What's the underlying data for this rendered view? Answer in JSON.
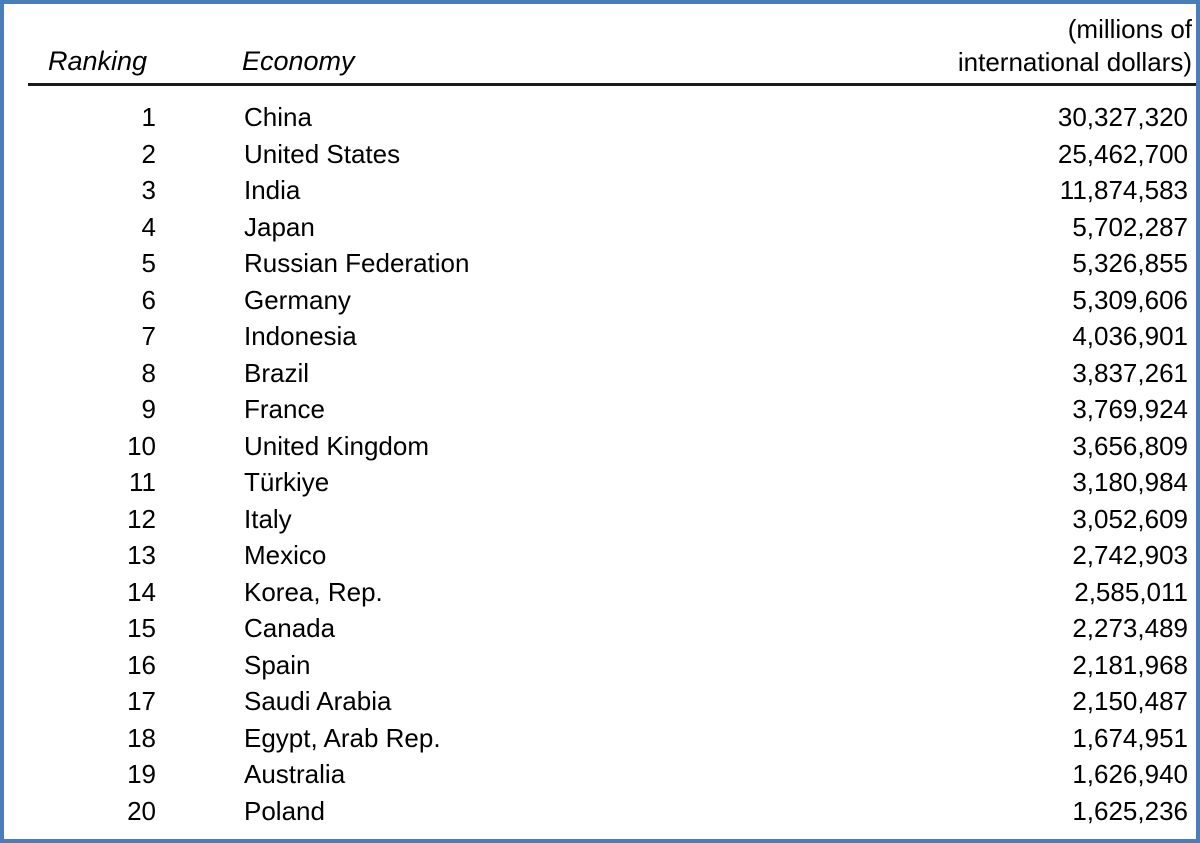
{
  "table": {
    "headers": {
      "ranking": "Ranking",
      "economy": "Economy",
      "units_line1": "(millions of",
      "units_line2": "international dollars)"
    },
    "border_color": "#4a7ebb",
    "rule_color": "#1a1a1a",
    "rows": [
      {
        "rank": "1",
        "economy": "China",
        "value": "30,327,320"
      },
      {
        "rank": "2",
        "economy": "United States",
        "value": "25,462,700"
      },
      {
        "rank": "3",
        "economy": "India",
        "value": "11,874,583"
      },
      {
        "rank": "4",
        "economy": "Japan",
        "value": "5,702,287"
      },
      {
        "rank": "5",
        "economy": "Russian Federation",
        "value": "5,326,855"
      },
      {
        "rank": "6",
        "economy": "Germany",
        "value": "5,309,606"
      },
      {
        "rank": "7",
        "economy": "Indonesia",
        "value": "4,036,901"
      },
      {
        "rank": "8",
        "economy": "Brazil",
        "value": "3,837,261"
      },
      {
        "rank": "9",
        "economy": "France",
        "value": "3,769,924"
      },
      {
        "rank": "10",
        "economy": "United Kingdom",
        "value": "3,656,809"
      },
      {
        "rank": "11",
        "economy": "Türkiye",
        "value": "3,180,984"
      },
      {
        "rank": "12",
        "economy": "Italy",
        "value": "3,052,609"
      },
      {
        "rank": "13",
        "economy": "Mexico",
        "value": "2,742,903"
      },
      {
        "rank": "14",
        "economy": "Korea, Rep.",
        "value": "2,585,011"
      },
      {
        "rank": "15",
        "economy": "Canada",
        "value": "2,273,489"
      },
      {
        "rank": "16",
        "economy": "Spain",
        "value": "2,181,968"
      },
      {
        "rank": "17",
        "economy": "Saudi Arabia",
        "value": "2,150,487"
      },
      {
        "rank": "18",
        "economy": "Egypt, Arab Rep.",
        "value": "1,674,951"
      },
      {
        "rank": "19",
        "economy": "Australia",
        "value": "1,626,940"
      },
      {
        "rank": "20",
        "economy": "Poland",
        "value": "1,625,236"
      }
    ]
  },
  "chart_data": {
    "type": "table",
    "title": "",
    "columns": [
      "Ranking",
      "Economy",
      "(millions of international dollars)"
    ],
    "categories": [
      "China",
      "United States",
      "India",
      "Japan",
      "Russian Federation",
      "Germany",
      "Indonesia",
      "Brazil",
      "France",
      "United Kingdom",
      "Türkiye",
      "Italy",
      "Mexico",
      "Korea, Rep.",
      "Canada",
      "Spain",
      "Saudi Arabia",
      "Egypt, Arab Rep.",
      "Australia",
      "Poland"
    ],
    "values": [
      30327320,
      25462700,
      11874583,
      5702287,
      5326855,
      5309606,
      4036901,
      3837261,
      3769924,
      3656809,
      3180984,
      3052609,
      2742903,
      2585011,
      2273489,
      2181968,
      2150487,
      1674951,
      1626940,
      1625236
    ],
    "xlabel": "Economy",
    "ylabel": "millions of international dollars"
  }
}
